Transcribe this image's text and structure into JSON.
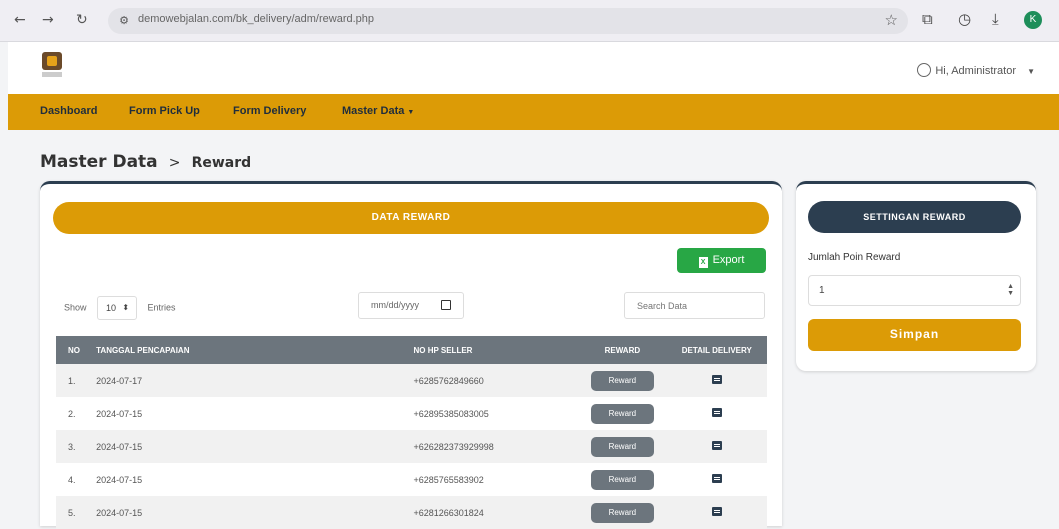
{
  "browser": {
    "url": "demowebjalan.com/bk_delivery/adm/reward.php",
    "profile_initial": "K"
  },
  "header": {
    "user_greeting": "Hi, Administrator"
  },
  "navbar": {
    "items": [
      "Dashboard",
      "Form Pick Up",
      "Form Delivery",
      "Master Data"
    ]
  },
  "breadcrumb": {
    "main": "Master Data",
    "separator": ">",
    "sub": "Reward"
  },
  "main_card": {
    "title": "DATA REWARD",
    "export_label": "Export",
    "show_label": "Show",
    "entries_value": "10",
    "entries_label": "Entries",
    "date_placeholder": "mm/dd/yyyy",
    "search_placeholder": "Search Data",
    "columns": [
      "NO",
      "TANGGAL PENCAPAIAN",
      "NO HP SELLER",
      "REWARD",
      "DETAIL DELIVERY"
    ],
    "reward_button_label": "Reward",
    "rows": [
      {
        "no": "1.",
        "date": "2024-07-17",
        "phone": "+6285762849660"
      },
      {
        "no": "2.",
        "date": "2024-07-15",
        "phone": "+62895385083005"
      },
      {
        "no": "3.",
        "date": "2024-07-15",
        "phone": "+626282373929998"
      },
      {
        "no": "4.",
        "date": "2024-07-15",
        "phone": "+6285765583902"
      },
      {
        "no": "5.",
        "date": "2024-07-15",
        "phone": "+6281266301824"
      }
    ]
  },
  "side_card": {
    "title": "SETTINGAN REWARD",
    "field_label": "Jumlah Poin Reward",
    "field_value": "1",
    "save_label": "Simpan"
  },
  "colors": {
    "accent": "#dc9b06",
    "dark": "#2c3e50",
    "success": "#28a745",
    "secondary": "#6c757d"
  }
}
